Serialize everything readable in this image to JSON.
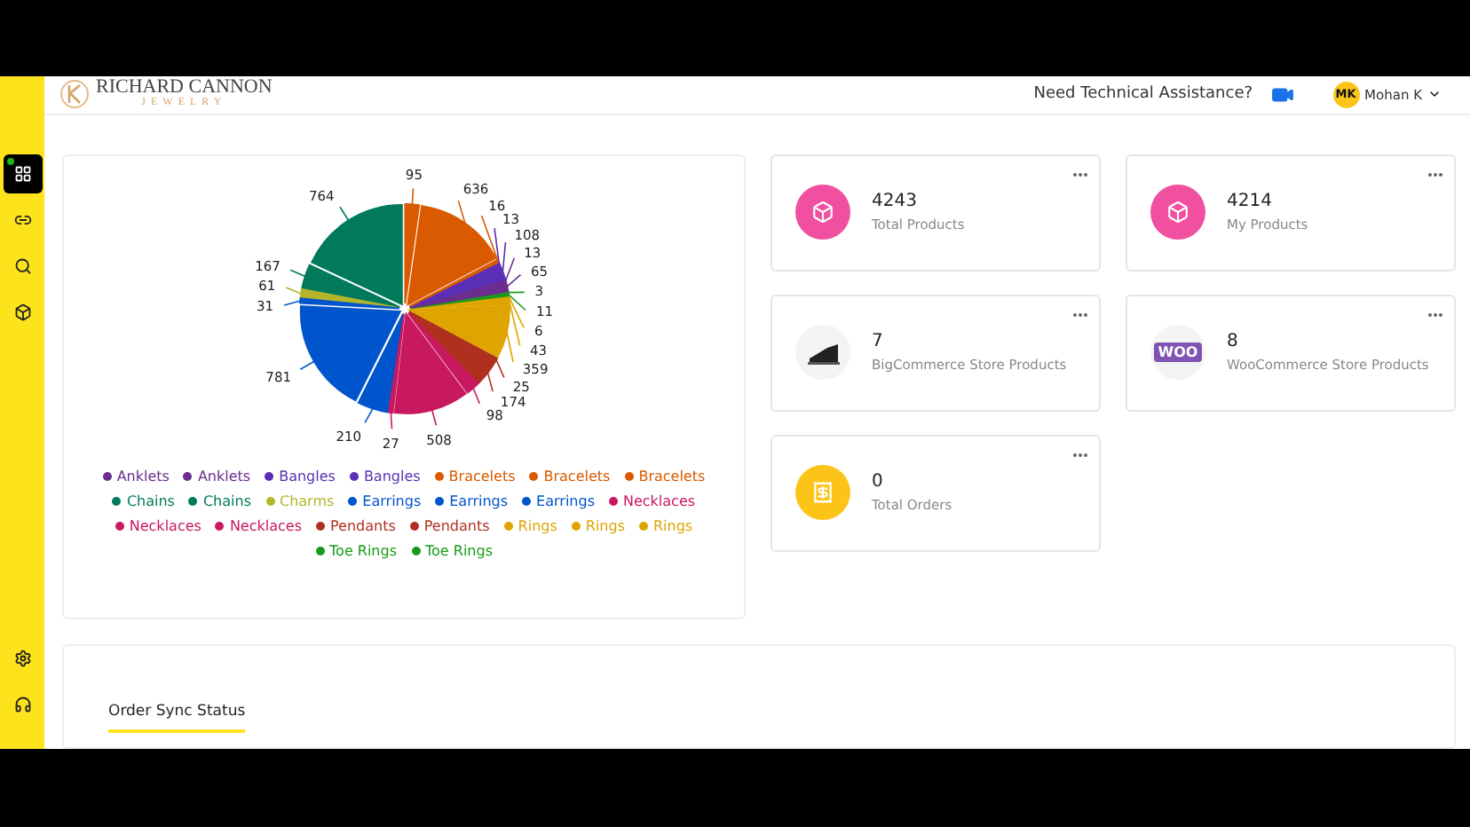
{
  "header": {
    "brand": "RICHARD CANNON",
    "brand_sub": "JEWELRY",
    "assist": "Need Technical Assistance?",
    "user": {
      "initials": "MK",
      "name": "Mohan K"
    }
  },
  "sidebar": {
    "items": [
      {
        "kind": "dashboard",
        "selected": true
      },
      {
        "kind": "link",
        "selected": false
      },
      {
        "kind": "search",
        "selected": false
      },
      {
        "kind": "box",
        "selected": false
      }
    ],
    "bottom_items": [
      {
        "kind": "settings",
        "selected": false
      },
      {
        "kind": "support",
        "selected": false
      }
    ]
  },
  "chart_card": {
    "chart_data": {
      "type": "pie",
      "data_labels": true,
      "categories": [
        "Anklets",
        "Anklets",
        "Bangles",
        "Bangles",
        "Bracelets",
        "Bracelets",
        "Bracelets",
        "Chains",
        "Chains",
        "Charms",
        "Earrings",
        "Earrings",
        "Earrings",
        "Necklaces",
        "Necklaces",
        "Necklaces",
        "Pendants",
        "Pendants",
        "Rings",
        "Rings",
        "Rings",
        "Toe Rings",
        "Toe Rings"
      ],
      "values": [
        65,
        13,
        108,
        13,
        16,
        636,
        95,
        764,
        167,
        61,
        31,
        781,
        210,
        27,
        508,
        98,
        174,
        25,
        359,
        43,
        6,
        11,
        3
      ],
      "colors": [
        "#6b2d8f",
        "#6b2d8f",
        "#5b2fb5",
        "#5b2fb5",
        "#d95a00",
        "#d95a00",
        "#d95a00",
        "#007a5a",
        "#007a5a",
        "#b5b52a",
        "#0055cc",
        "#0055cc",
        "#0055cc",
        "#c8185f",
        "#c8185f",
        "#c8185f",
        "#b03020",
        "#b03020",
        "#dea500",
        "#dea500",
        "#dea500",
        "#1a9a1a",
        "#1a9a1a"
      ]
    }
  },
  "stats": [
    {
      "kind": "box",
      "value": "4243",
      "label": "Total Products"
    },
    {
      "kind": "box",
      "value": "4214",
      "label": "My Products"
    },
    {
      "kind": "bigcommerce",
      "value": "7",
      "label": "BigCommerce Store Products"
    },
    {
      "kind": "woo",
      "value": "8",
      "label": "WooCommerce Store Products",
      "logo_text": "WOO"
    },
    {
      "kind": "orders",
      "value": "0",
      "label": "Total Orders"
    }
  ],
  "sync": {
    "title": "Order Sync Status"
  }
}
